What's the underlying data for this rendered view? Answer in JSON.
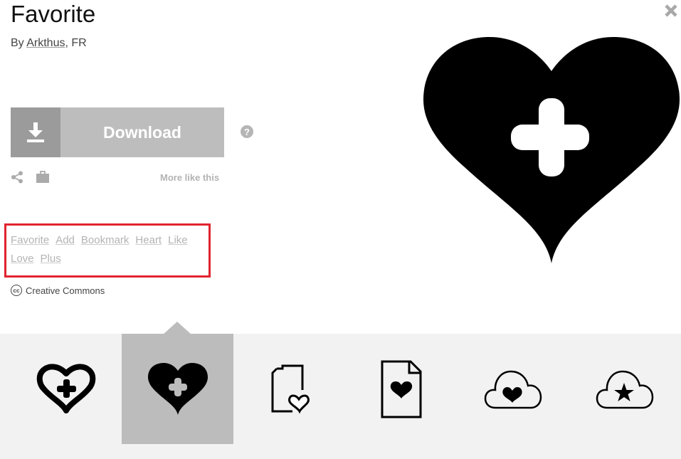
{
  "icon": {
    "title": "Favorite",
    "by_prefix": "By ",
    "author": "Arkthus",
    "location_suffix": ", FR"
  },
  "actions": {
    "download_label": "Download",
    "help_symbol": "?",
    "more_like_this": "More like this"
  },
  "tags": [
    "Favorite",
    "Add",
    "Bookmark",
    "Heart",
    "Like",
    "Love",
    "Plus"
  ],
  "license": {
    "badge": "cc",
    "label": "Creative Commons"
  },
  "related_icons": [
    {
      "name": "heart-outline-plus-icon"
    },
    {
      "name": "heart-filled-plus-icon",
      "selected": true
    },
    {
      "name": "document-heart-icon"
    },
    {
      "name": "file-heart-icon"
    },
    {
      "name": "cloud-heart-icon"
    },
    {
      "name": "cloud-star-icon"
    }
  ],
  "colors": {
    "highlight_border": "#e0242f",
    "download_icon_bg": "#9b9b9b",
    "download_bg": "#bdbdbd",
    "strip_bg": "#f2f2f2",
    "selected_thumb_bg": "#bcbcbc"
  }
}
